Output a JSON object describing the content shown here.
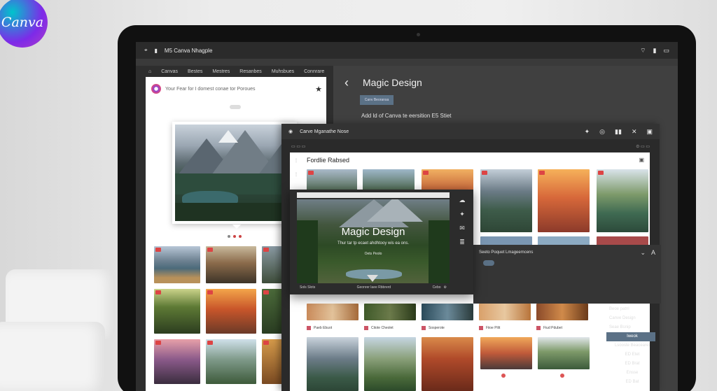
{
  "brand": {
    "logo_text": "Canva",
    "colors": {
      "logo_a": "#00c4cc",
      "logo_b": "#7d2ae8",
      "accent": "#5b7186"
    }
  },
  "statusbar": {
    "left": "M5 Canva Nhagple",
    "icons": [
      "location-icon",
      "wifi-icon",
      "battery-icon"
    ]
  },
  "left_app": {
    "menu": [
      "Canvas",
      "Bestes",
      "Mestres",
      "Resanbes",
      "Muhsbues",
      "Connrare"
    ],
    "card_header": "Your Fear for I domest conae tor Poroues",
    "carousel_dots": 3
  },
  "right_app": {
    "title": "Magic Design",
    "chip": "Canv Beoransa",
    "description": "Add ld of Canva te eersition E5 Stiet"
  },
  "panel": {
    "header": "Carve Mganathe Nose",
    "sheet_title": "Fordlie Rabsed",
    "captions": [
      "Paeb Ebuot",
      "Citote Cheolet",
      "Sosperote",
      "Fiioe Pilit",
      "Fiud Pdubet"
    ]
  },
  "overlay": {
    "title": "Magic Design",
    "subtitle": "Thur tar tp ecaet ahdhtooy wis ea ons.",
    "caption": "Oets Peolo",
    "footer_left": "Sols  Slots",
    "footer_mid": "Geonrer laee Rbbrerd",
    "footer_right": "Cebo"
  },
  "detail_panel": {
    "title": "Seeto Poquet Lmageemcens"
  },
  "right_list": [
    "Beoe patnl",
    "Canve Design",
    "Seae Bsnip",
    "Iweok",
    "Lsooste Beacearet",
    "ED Etet",
    "ED Brat",
    "Ensse",
    "ED Bat"
  ]
}
